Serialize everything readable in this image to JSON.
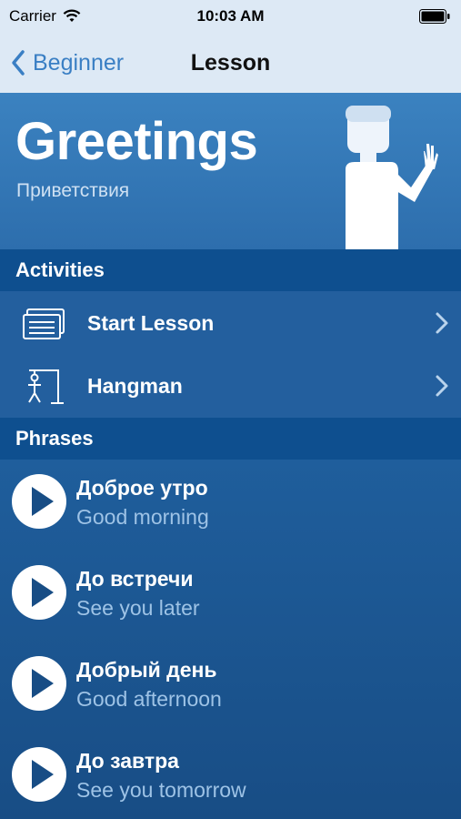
{
  "status_bar": {
    "carrier": "Carrier",
    "time": "10:03 AM"
  },
  "nav": {
    "back_label": "Beginner",
    "title": "Lesson"
  },
  "hero": {
    "title": "Greetings",
    "subtitle": "Приветствия"
  },
  "activities": {
    "header": "Activities",
    "items": [
      {
        "label": "Start Lesson",
        "icon": "flashcards-icon"
      },
      {
        "label": "Hangman",
        "icon": "hangman-icon"
      }
    ]
  },
  "phrases": {
    "header": "Phrases",
    "items": [
      {
        "ru": "Доброе утро",
        "en": "Good morning"
      },
      {
        "ru": "До встречи",
        "en": "See you later"
      },
      {
        "ru": "Добрый день",
        "en": "Good afternoon"
      },
      {
        "ru": "До завтра",
        "en": "See you tomorrow"
      }
    ]
  },
  "colors": {
    "accent": "#3a7fc4",
    "header_bg": "#0e4f8f",
    "row_bg": "#235f9e",
    "subtext": "#9ec3e6"
  }
}
